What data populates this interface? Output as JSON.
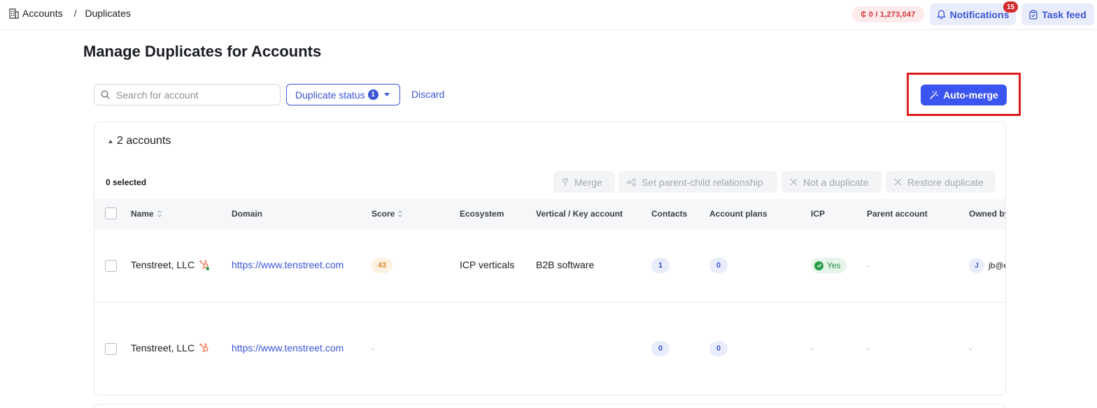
{
  "breadcrumb": {
    "root": "Accounts",
    "separator": "/",
    "current": "Duplicates"
  },
  "credits": "₵ 0 / 1,273,047",
  "notifications": {
    "label": "Notifications",
    "count": "15"
  },
  "task_feed": {
    "label": "Task feed"
  },
  "page_title": "Manage Duplicates for Accounts",
  "search": {
    "placeholder": "Search for account",
    "value": ""
  },
  "duplicate_status": {
    "label": "Duplicate status",
    "count": "1"
  },
  "discard_label": "Discard",
  "automerge_label": "Auto-merge",
  "group": {
    "label": "2 accounts"
  },
  "selected_label": "0 selected",
  "actions": {
    "merge": "Merge",
    "parent_child": "Set parent-child relationship",
    "not_duplicate": "Not a duplicate",
    "restore": "Restore duplicate"
  },
  "columns": {
    "name": "Name",
    "domain": "Domain",
    "score": "Score",
    "ecosystem": "Ecosystem",
    "vertical": "Vertical / Key account",
    "contacts": "Contacts",
    "account_plans": "Account plans",
    "icp": "ICP",
    "parent_account": "Parent account",
    "owned_by": "Owned by"
  },
  "rows": [
    {
      "name": "Tenstreet, LLC",
      "domain": "https://www.tenstreet.com",
      "score": "43",
      "ecosystem": "ICP verticals",
      "vertical": "B2B software",
      "contacts": "1",
      "account_plans": "0",
      "icp": "Yes",
      "parent_account": "-",
      "owner_initial": "J",
      "owner": "jb@e"
    },
    {
      "name": "Tenstreet, LLC",
      "domain": "https://www.tenstreet.com",
      "score": "-",
      "ecosystem": "",
      "vertical": "",
      "contacts": "0",
      "account_plans": "0",
      "icp": "-",
      "parent_account": "-",
      "owner": "-"
    }
  ],
  "colors": {
    "accent": "#3c55d6",
    "primary_button": "#3c55f0",
    "highlight_box": "#e01b1b",
    "badge": "#d32c2c",
    "score": "#d98a2b",
    "icp_yes": "#2a8c45",
    "hubspot": "#ff7a59"
  },
  "icons": [
    "building-icon",
    "bell-icon",
    "clipboard-icon",
    "search-icon",
    "caret-down-icon",
    "wand-icon",
    "merge-icon",
    "hierarchy-icon",
    "close-icon",
    "sort-icon",
    "hubspot-icon",
    "check-icon"
  ]
}
